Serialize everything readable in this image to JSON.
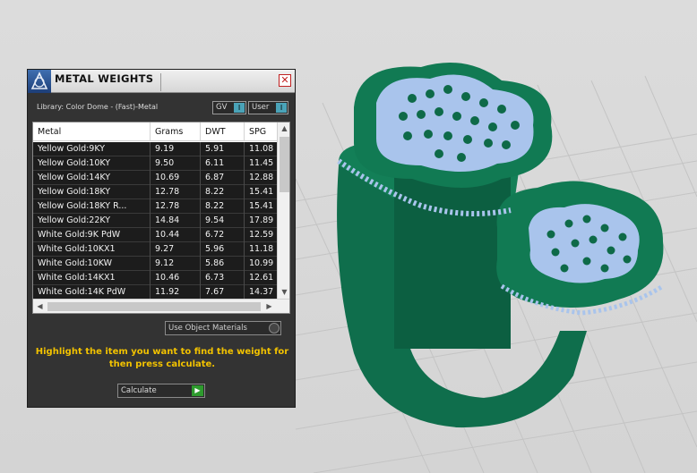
{
  "panel": {
    "title": "METAL WEIGHTS",
    "close_glyph": "✕",
    "library_label": "Library: Color Dome - (Fast)-Metal",
    "toggle_gv": "GV",
    "toggle_user": "User",
    "toggle_knob": "I",
    "use_object_materials": "Use Object Materials",
    "hint": "Highlight the item you want to find the weight for then press calculate.",
    "calculate_label": "Calculate",
    "calculate_icon": "play-icon",
    "calculate_glyph": "▶"
  },
  "table": {
    "headers": [
      "Metal",
      "Grams",
      "DWT",
      "SPG"
    ],
    "rows": [
      [
        "Yellow Gold:9KY",
        "9.19",
        "5.91",
        "11.08"
      ],
      [
        "Yellow Gold:10KY",
        "9.50",
        "6.11",
        "11.45"
      ],
      [
        "Yellow Gold:14KY",
        "10.69",
        "6.87",
        "12.88"
      ],
      [
        "Yellow Gold:18KY",
        "12.78",
        "8.22",
        "15.41"
      ],
      [
        "Yellow Gold:18KY R...",
        "12.78",
        "8.22",
        "15.41"
      ],
      [
        "Yellow Gold:22KY",
        "14.84",
        "9.54",
        "17.89"
      ],
      [
        "White Gold:9K PdW",
        "10.44",
        "6.72",
        "12.59"
      ],
      [
        "White Gold:10KX1",
        "9.27",
        "5.96",
        "11.18"
      ],
      [
        "White Gold:10KW",
        "9.12",
        "5.86",
        "10.99"
      ],
      [
        "White Gold:14KX1",
        "10.46",
        "6.73",
        "12.61"
      ],
      [
        "White Gold:14K PdW",
        "11.92",
        "7.67",
        "14.37"
      ]
    ],
    "scroll_up": "▲",
    "scroll_down": "▼",
    "scroll_left": "◀",
    "scroll_right": "▶"
  },
  "colors": {
    "ring_green": "#0f6e4c",
    "gem_blue": "#a9c4ec",
    "hint_yellow": "#f2c200"
  }
}
